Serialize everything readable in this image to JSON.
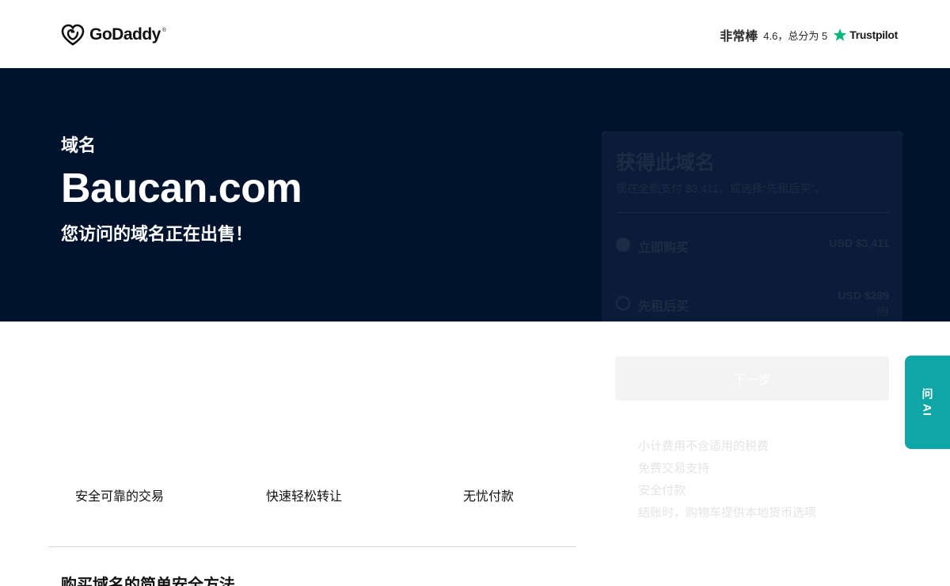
{
  "header": {
    "logo_text": "GoDaddy",
    "logo_tm": "®",
    "rating_word": "非常棒",
    "rating_score": "4.6，总分为 5",
    "trustpilot_name": "Trustpilot",
    "trustpilot_color": "#00b67a"
  },
  "hero": {
    "kicker": "域名",
    "domain": "Baucan.com",
    "subtitle": "您访问的域名正在出售！",
    "background": "#00132d"
  },
  "purchase_card": {
    "title": "获得此域名",
    "subtitle": "现在全额支付 $3,411，或选择“先租后买”。",
    "options": [
      {
        "label": "立即购买",
        "price": "USD $3,411",
        "unit": "",
        "selected": true
      },
      {
        "label": "先租后买",
        "price": "USD $289",
        "unit": "/月",
        "selected": false
      }
    ],
    "next_button": "下一步",
    "perks": [
      "小计费用不含适用的税费",
      "免费交易支持",
      "安全付款",
      "结账时，购物车提供本地货币选项"
    ]
  },
  "ai_tab": {
    "label": "问 AI",
    "color": "#10a5a6"
  },
  "features": [
    {
      "label": "安全可靠的交易"
    },
    {
      "label": "快速轻松转让"
    },
    {
      "label": "无忧付款"
    }
  ],
  "section": {
    "title": "购买域名的简单安全方法"
  }
}
